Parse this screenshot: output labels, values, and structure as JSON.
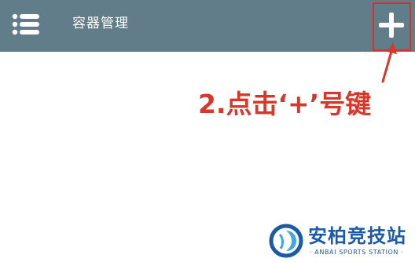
{
  "appbar": {
    "menu_icon": "menu-icon",
    "title": "容器管理",
    "add_icon": "plus-icon",
    "background_color": "#617d8a"
  },
  "annotation": {
    "text": "2.点击‘+’号键",
    "color": "#d8372b",
    "highlight_color": "#d5322a"
  },
  "watermark": {
    "name": "安柏竞技站",
    "subtitle": "· ANBAI SPORTS STATION ·",
    "color": "#1d5aa6"
  }
}
